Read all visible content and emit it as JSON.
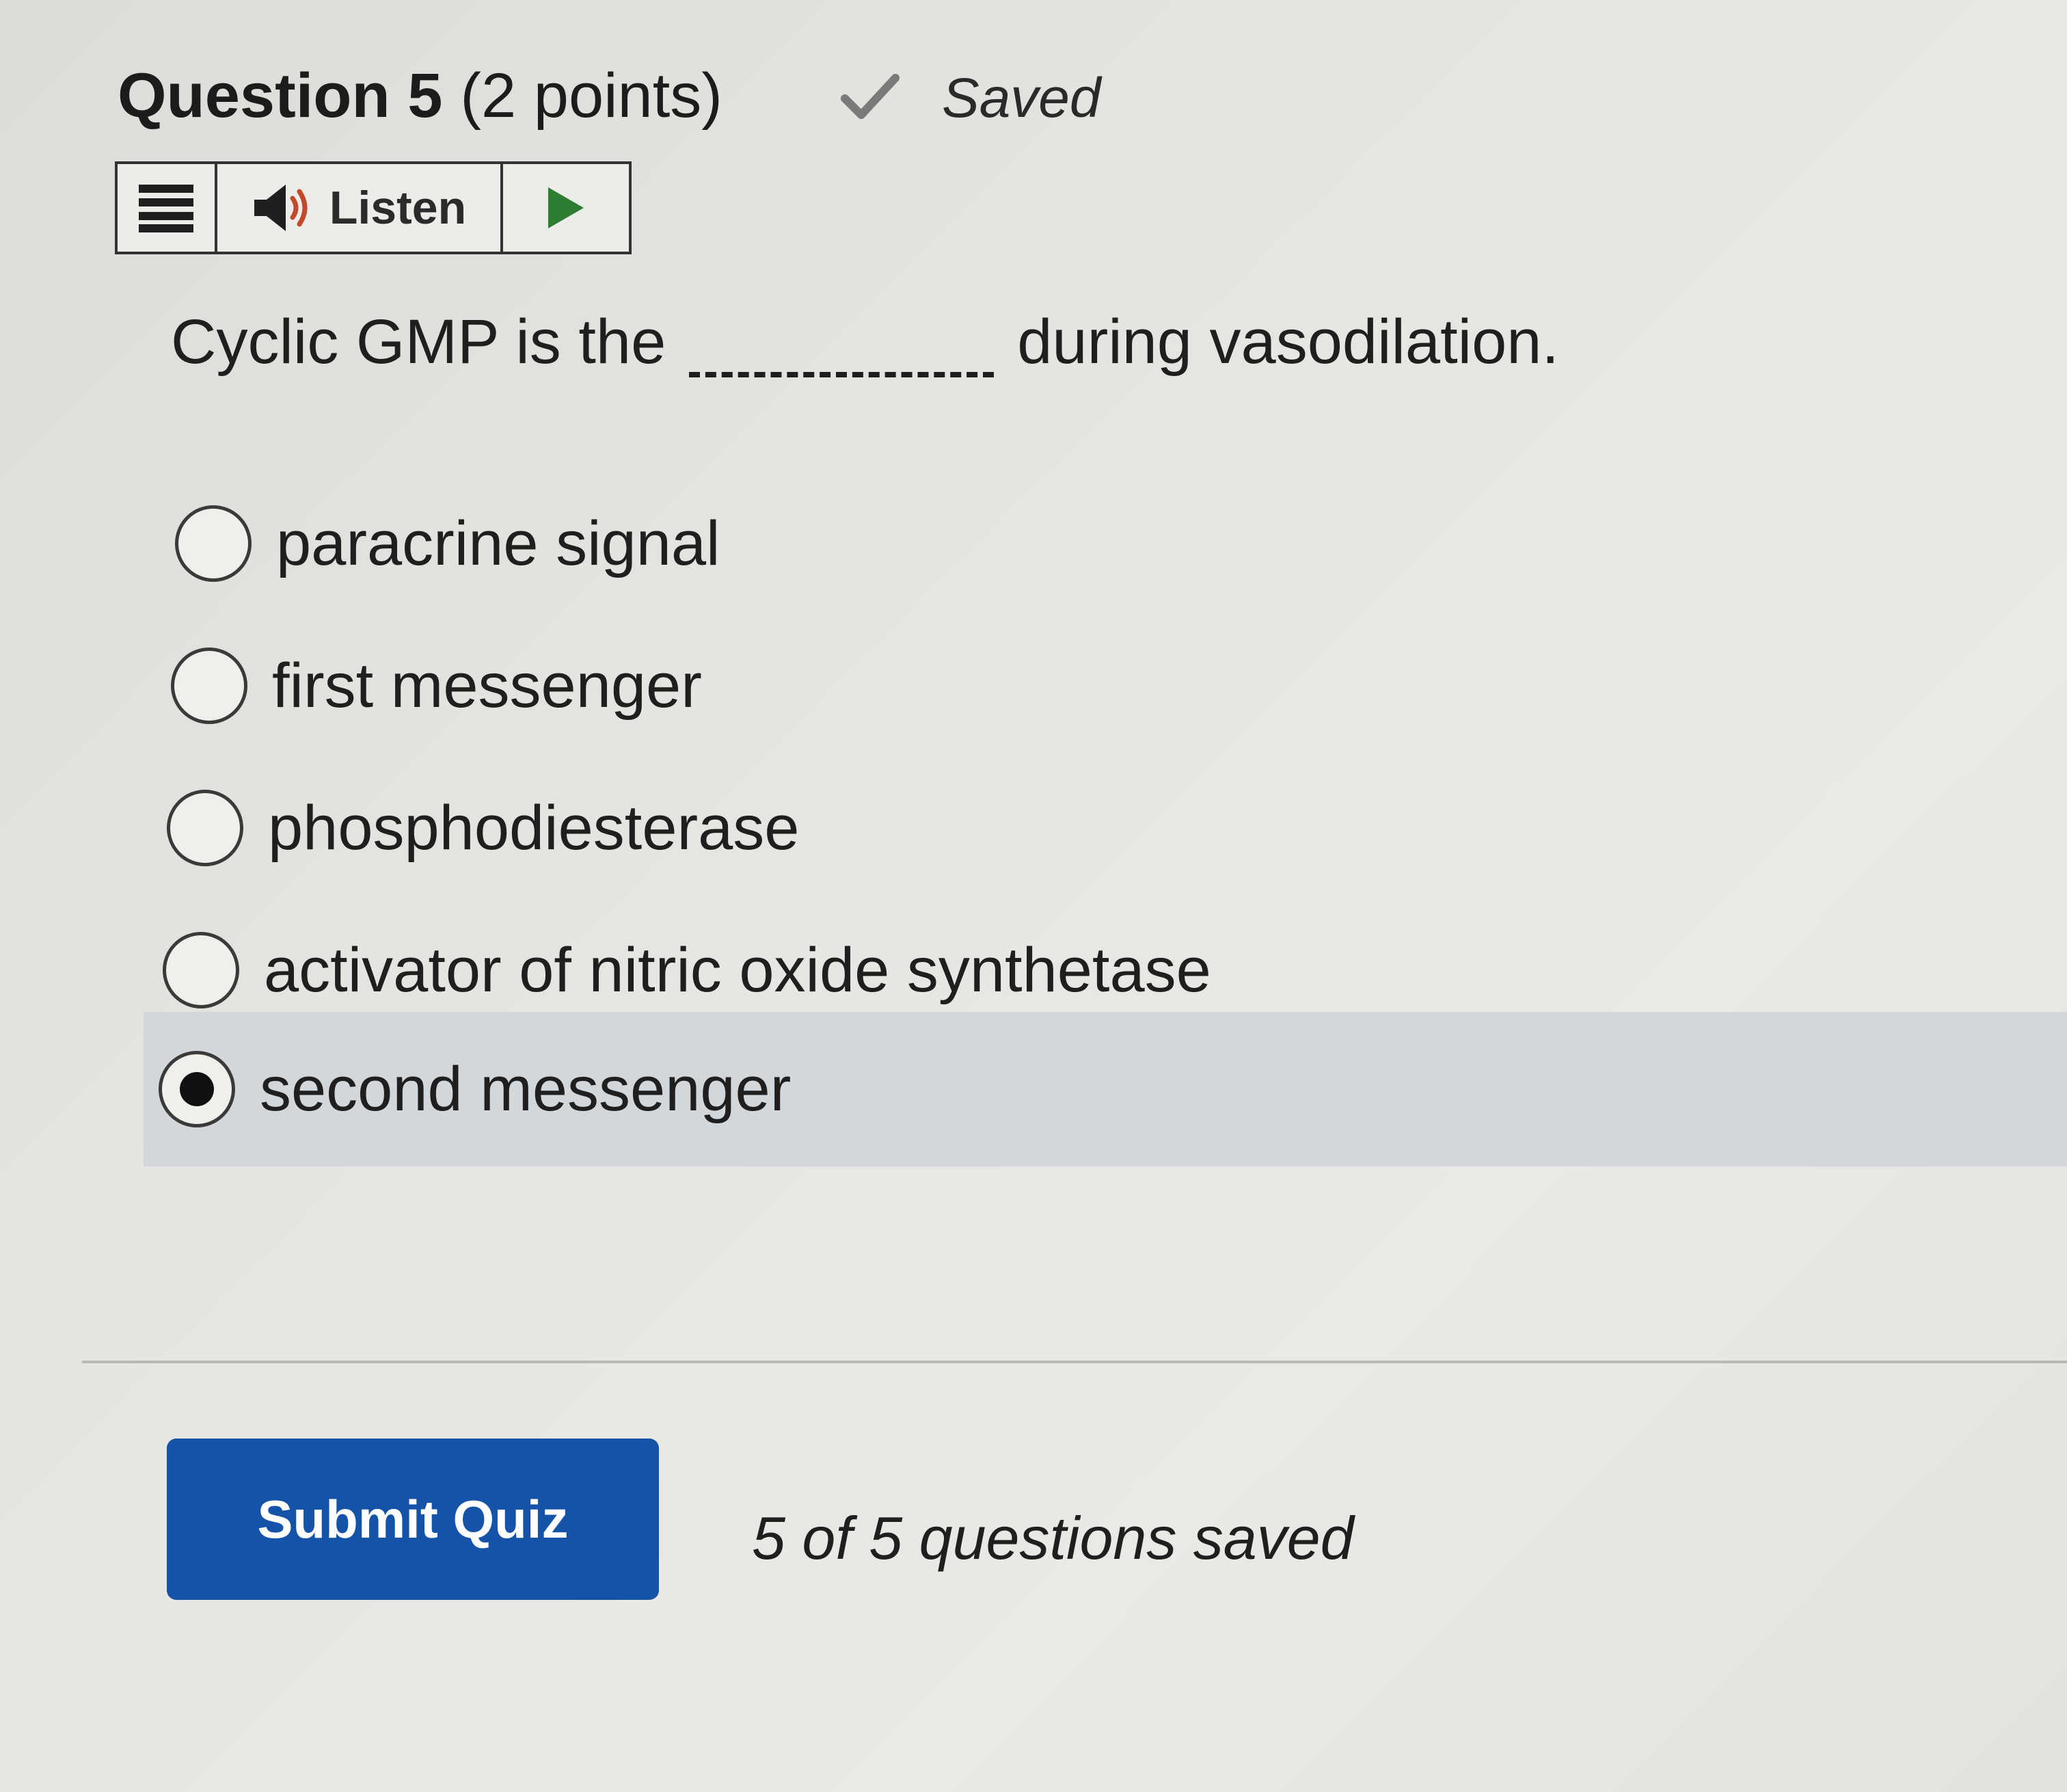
{
  "question": {
    "label": "Question 5",
    "points": "(2 points)",
    "saved_status": "Saved",
    "text_before": "Cyclic GMP is the",
    "text_after": "during vasodilation."
  },
  "listen_bar": {
    "menu_icon": "menu-icon",
    "speaker_icon": "speaker-icon",
    "label": "Listen",
    "play_icon": "play-icon",
    "play_color": "#2e7d32"
  },
  "options": [
    {
      "label": "paracrine signal",
      "selected": false
    },
    {
      "label": "first messenger",
      "selected": false
    },
    {
      "label": "phosphodiesterase",
      "selected": false
    },
    {
      "label": "activator of nitric oxide synthetase",
      "selected": false
    },
    {
      "label": "second messenger",
      "selected": true
    }
  ],
  "footer": {
    "submit_label": "Submit Quiz",
    "saved_count": "5 of 5 questions saved"
  },
  "colors": {
    "submit_bg": "#1553a8",
    "selected_row_bg": "#d2d7dc"
  }
}
